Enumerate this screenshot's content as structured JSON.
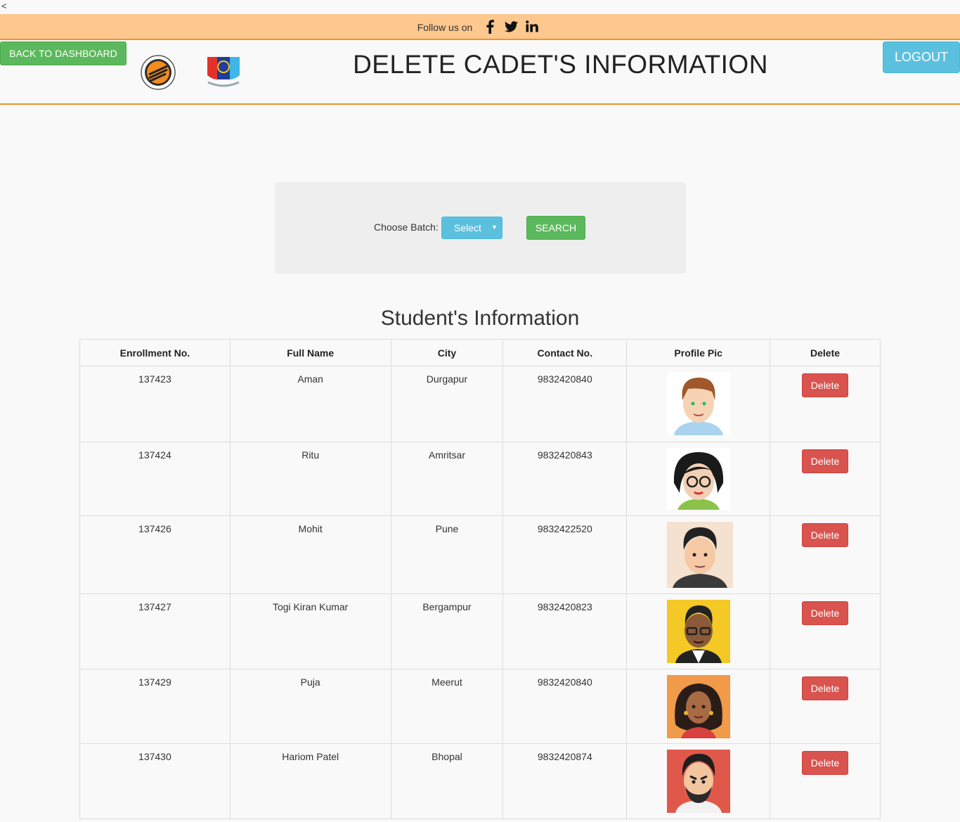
{
  "nav": {
    "back_glyph": "<"
  },
  "follow": {
    "label": "Follow us on",
    "icons": [
      "facebook-icon",
      "twitter-icon",
      "linkedin-icon"
    ]
  },
  "header": {
    "back_button": "BACK TO DASHBOARD",
    "title": "DELETE CADET'S INFORMATION",
    "logout_button": "LOGOUT"
  },
  "search": {
    "label": "Choose Batch:",
    "select_value": "Select",
    "button": "SEARCH"
  },
  "table": {
    "title": "Student's Information",
    "columns": [
      "Enrollment No.",
      "Full Name",
      "City",
      "Contact No.",
      "Profile Pic",
      "Delete"
    ],
    "rows": [
      {
        "enrollment": "137423",
        "name": "Aman",
        "city": "Durgapur",
        "contact": "9832420840",
        "delete": "Delete"
      },
      {
        "enrollment": "137424",
        "name": "Ritu",
        "city": "Amritsar",
        "contact": "9832420843",
        "delete": "Delete"
      },
      {
        "enrollment": "137426",
        "name": "Mohit",
        "city": "Pune",
        "contact": "9832422520",
        "delete": "Delete"
      },
      {
        "enrollment": "137427",
        "name": "Togi Kiran Kumar",
        "city": "Bergampur",
        "contact": "9832420823",
        "delete": "Delete"
      },
      {
        "enrollment": "137429",
        "name": "Puja",
        "city": "Meerut",
        "contact": "9832420840",
        "delete": "Delete"
      },
      {
        "enrollment": "137430",
        "name": "Hariom Patel",
        "city": "Bhopal",
        "contact": "9832420874",
        "delete": "Delete"
      }
    ]
  },
  "colors": {
    "follow_bar": "#fcc88e",
    "accent_orange": "#f0932b",
    "success_green": "#5cb85c",
    "info_blue": "#5bc0de",
    "danger_red": "#d9534f"
  }
}
